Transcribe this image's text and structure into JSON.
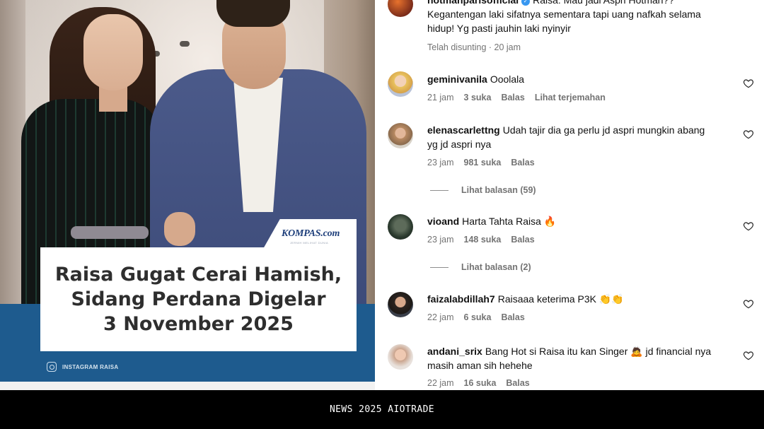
{
  "post": {
    "brand": "KOMPAS.com",
    "brand_tagline": "JERNIH MELIHAT DUNIA",
    "headline_lines": [
      "Raisa Gugat Cerai Hamish,",
      "Sidang Perdana Digelar",
      "3 November 2025"
    ],
    "photo_credit": "INSTAGRAM RAISA"
  },
  "comments": [
    {
      "user": "hotmanparisofficial",
      "verified": true,
      "text_line1": "Raisa: Mau jadi Aspri Hotman??",
      "text_line2": "Kegantengan laki sifatnya sementara tapi uang nafkah selama",
      "text_line3": "hidup! Yg pasti jauhin laki nyinyir",
      "meta": "Telah disunting · 20 jam"
    },
    {
      "user": "geminivanila",
      "text": "Ooolala",
      "time": "21 jam",
      "likes": "3 suka",
      "reply": "Balas",
      "translate": "Lihat terjemahan"
    },
    {
      "user": "elenascarlettng",
      "text_line1": "Udah tajir dia ga perlu jd aspri mungkin abang",
      "text_line2": "yg jd aspri nya",
      "time": "23 jam",
      "likes": "981 suka",
      "reply": "Balas",
      "view_replies": "Lihat balasan (59)"
    },
    {
      "user": "vioand",
      "text": "Harta Tahta Raisa 🔥",
      "time": "23 jam",
      "likes": "148 suka",
      "reply": "Balas",
      "view_replies": "Lihat balasan (2)"
    },
    {
      "user": "faizalabdillah7",
      "text": "Raisaaa keterima P3K 👏👏",
      "time": "22 jam",
      "likes": "6 suka",
      "reply": "Balas"
    },
    {
      "user": "andani_srix",
      "text_line1": "Bang Hot si Raisa itu kan Singer 🙇 jd financial nya",
      "text_line2": "masih aman sih hehehe",
      "time": "22 jam",
      "likes": "16 suka",
      "reply": "Balas"
    }
  ],
  "caption": "NEWS 2025 AIOTRADE",
  "colors": {
    "band": "#1e5b8e",
    "meta": "#737373",
    "verified": "#3797f0"
  }
}
